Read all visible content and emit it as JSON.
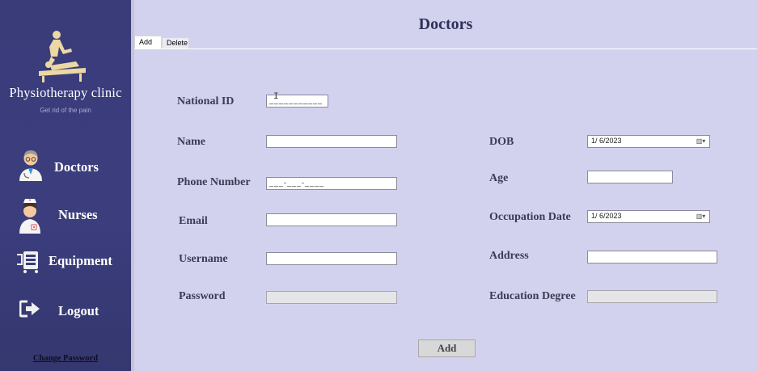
{
  "sidebar": {
    "brand_name": "Physiotherapy clinic",
    "brand_tagline": "Get rid of the pain",
    "items": [
      {
        "label": "Doctors",
        "icon": "doctor-icon"
      },
      {
        "label": "Nurses",
        "icon": "nurse-icon"
      },
      {
        "label": "Equipment",
        "icon": "equipment-icon"
      },
      {
        "label": "Logout",
        "icon": "logout-icon"
      }
    ],
    "change_password": "Change Password"
  },
  "header": {
    "title": "Doctors"
  },
  "tabs": [
    {
      "label": "Add",
      "active": true
    },
    {
      "label": "Delete",
      "active": false
    }
  ],
  "form": {
    "national_id": {
      "label": "National ID",
      "value": "___________"
    },
    "name": {
      "label": "Name",
      "value": ""
    },
    "phone": {
      "label": "Phone Number",
      "value": "___-___-____"
    },
    "email": {
      "label": "Email",
      "value": ""
    },
    "username": {
      "label": "Username",
      "value": ""
    },
    "password": {
      "label": "Password",
      "value": ""
    },
    "dob": {
      "label": "DOB",
      "value": "1/  6/2023"
    },
    "age": {
      "label": "Age",
      "value": ""
    },
    "occupation_date": {
      "label": "Occupation Date",
      "value": "1/  6/2023"
    },
    "address": {
      "label": "Address",
      "value": ""
    },
    "education_degree": {
      "label": "Education Degree",
      "value": ""
    }
  },
  "add_button": "Add",
  "colors": {
    "sidebar_bg": "#3a3c7a",
    "main_bg": "#d3d2ee",
    "title": "#2e3158"
  }
}
